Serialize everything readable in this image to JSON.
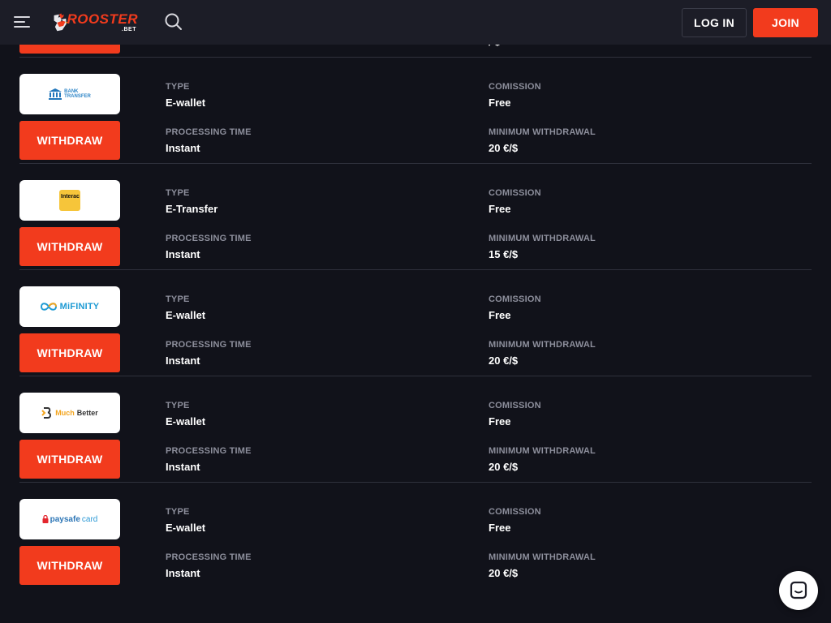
{
  "header": {
    "logo_name": "ROOSTER",
    "logo_sub": ".BET",
    "login_label": "LOG IN",
    "join_label": "JOIN"
  },
  "previous_row": {
    "min_value": "/ $"
  },
  "labels": {
    "type": "TYPE",
    "commission": "COMISSION",
    "processing": "PROCESSING TIME",
    "minimum": "MINIMUM WITHDRAWAL",
    "withdraw": "WITHDRAW"
  },
  "methods": [
    {
      "name": "Bank Transfer",
      "logo_text_1": "BANK",
      "logo_text_2": "TRANSFER",
      "type": "E-wallet",
      "commission": "Free",
      "processing": "Instant",
      "minimum": "20 €/$"
    },
    {
      "name": "Interac",
      "logo_text_1": "Interac",
      "type": "E-Transfer",
      "commission": "Free",
      "processing": "Instant",
      "minimum": "15 €/$"
    },
    {
      "name": "MiFinity",
      "logo_text_1": "MiFINITY",
      "type": "E-wallet",
      "commission": "Free",
      "processing": "Instant",
      "minimum": "20 €/$"
    },
    {
      "name": "MuchBetter",
      "logo_text_1": "Much",
      "logo_text_2": "Better",
      "type": "E-wallet",
      "commission": "Free",
      "processing": "Instant",
      "minimum": "20 €/$"
    },
    {
      "name": "paysafecard",
      "logo_text_1": "paysafe",
      "logo_text_2": "card",
      "type": "E-wallet",
      "commission": "Free",
      "processing": "Instant",
      "minimum": "20 €/$"
    }
  ],
  "colors": {
    "accent": "#f23b1d",
    "background": "#11121a",
    "header": "#1c1d27",
    "label": "#8d8f9c"
  },
  "icons": [
    "menu-icon",
    "rooster-logo-icon",
    "search-icon",
    "chat-icon",
    "bank-icon",
    "lock-icon"
  ]
}
